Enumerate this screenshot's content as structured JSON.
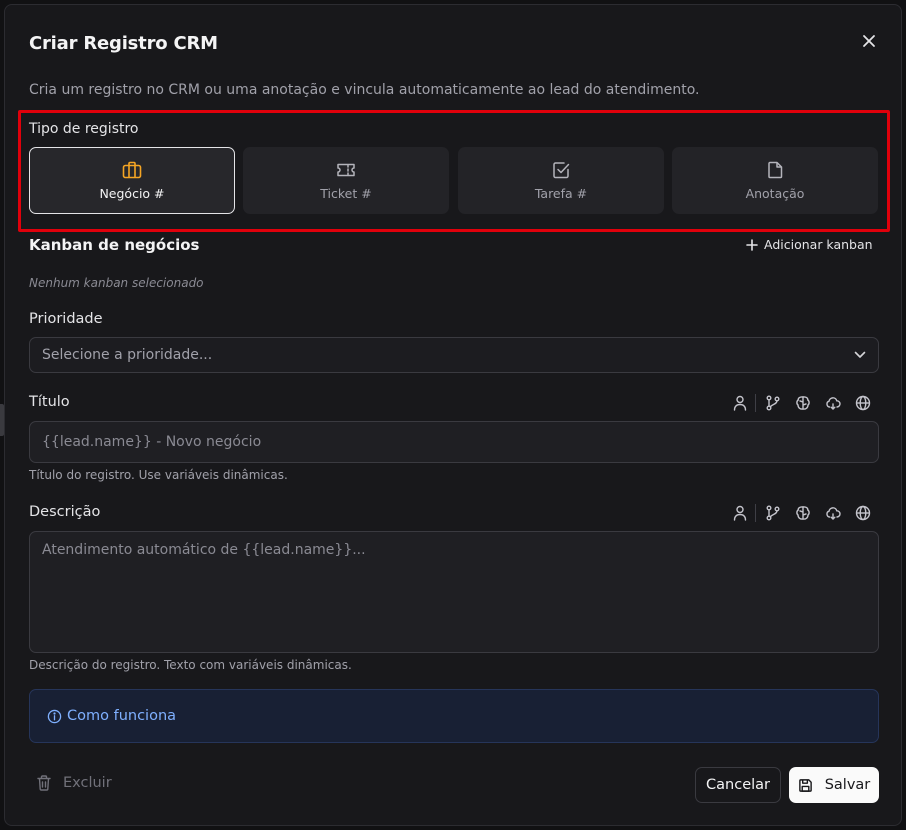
{
  "dialog": {
    "title": "Criar Registro CRM",
    "subtitle": "Cria um registro no CRM ou uma anotação e vincula automaticamente ao lead do atendimento."
  },
  "record_type": {
    "label": "Tipo de registro",
    "options": [
      {
        "label": "Negócio #",
        "icon": "briefcase-icon",
        "selected": true
      },
      {
        "label": "Ticket #",
        "icon": "ticket-icon",
        "selected": false
      },
      {
        "label": "Tarefa #",
        "icon": "checkbox-icon",
        "selected": false
      },
      {
        "label": "Anotação",
        "icon": "file-icon",
        "selected": false
      }
    ]
  },
  "kanban": {
    "title": "Kanban de negócios",
    "add_label": "Adicionar kanban",
    "empty_text": "Nenhum kanban selecionado"
  },
  "priority": {
    "label": "Prioridade",
    "placeholder": "Selecione a prioridade..."
  },
  "title_field": {
    "label": "Título",
    "placeholder": "{{lead.name}} - Novo negócio",
    "hint": "Título do registro. Use variáveis dinâmicas."
  },
  "description_field": {
    "label": "Descrição",
    "placeholder": "Atendimento automático de {{lead.name}}...",
    "hint": "Descrição do registro. Texto com variáveis dinâmicas."
  },
  "variable_tools": [
    "user-icon",
    "git-branch-icon",
    "brain-icon",
    "cloud-icon",
    "globe-icon"
  ],
  "info": {
    "label": "Como funciona"
  },
  "footer": {
    "delete_label": "Excluir",
    "cancel_label": "Cancelar",
    "save_label": "Salvar"
  },
  "colors": {
    "accent_selected_icon": "#f5a524",
    "info_text": "#7fb0ff",
    "highlight": "#e0000b"
  }
}
